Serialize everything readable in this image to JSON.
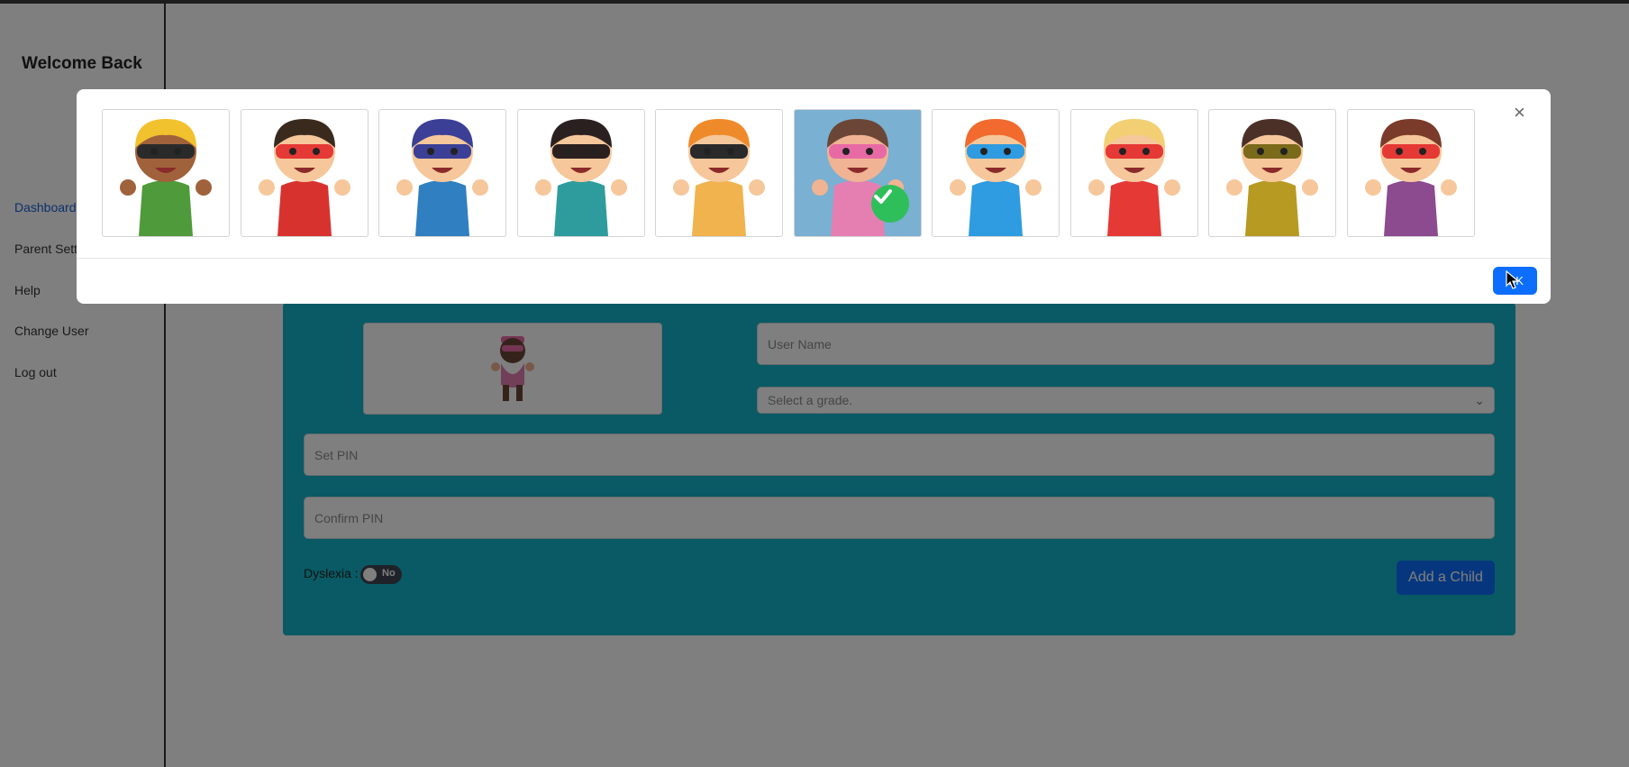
{
  "sidebar": {
    "welcome": "Welcome Back",
    "items": [
      {
        "label": "Dashboard",
        "active": true
      },
      {
        "label": "Parent Sett",
        "active": false
      },
      {
        "label": "Help",
        "active": false
      },
      {
        "label": "Change User",
        "active": false
      },
      {
        "label": "Log out",
        "active": false
      }
    ]
  },
  "form": {
    "username_placeholder": "User Name",
    "grade_placeholder": "Select a grade.",
    "pin_placeholder": "Set PIN",
    "confirm_pin_placeholder": "Confirm PIN",
    "dyslexia_label": "Dyslexia :",
    "dyslexia_toggle": "No",
    "add_button": "Add a Child"
  },
  "modal": {
    "close_glyph": "×",
    "ok_label": "OK",
    "selected_index": 5,
    "avatars": [
      {
        "name": "helmet-hero",
        "hair": "#f2c12e",
        "mask": "#2a2a2a",
        "body": "#4f9a3a",
        "skin": "#a0623b",
        "selected": false
      },
      {
        "name": "red-mask-boy",
        "hair": "#3a2a1e",
        "mask": "#e53935",
        "body": "#d8322f",
        "skin": "#f6c79a",
        "selected": false
      },
      {
        "name": "blue-caped-hero",
        "hair": "#3b3f96",
        "mask": "#3b3f96",
        "body": "#2f7fc1",
        "skin": "#f6c79a",
        "selected": false
      },
      {
        "name": "lightning-hero",
        "hair": "#2b2020",
        "mask": "#2b2020",
        "body": "#2e9c9c",
        "skin": "#f6c79a",
        "selected": false
      },
      {
        "name": "spiky-hero",
        "hair": "#ef8a2a",
        "mask": "#2a2a2a",
        "body": "#f1b34d",
        "skin": "#f6c79a",
        "selected": false
      },
      {
        "name": "bearded-hero",
        "hair": "#6b4636",
        "mask": "#e86aa5",
        "body": "#e57fb2",
        "skin": "#f0b393",
        "selected": true
      },
      {
        "name": "goggle-girl",
        "hair": "#f26a2e",
        "mask": "#2f9be0",
        "body": "#2f9be0",
        "skin": "#f6c79a",
        "selected": false
      },
      {
        "name": "blonde-heroine",
        "hair": "#f3cf74",
        "mask": "#e53935",
        "body": "#e53935",
        "skin": "#f6c79a",
        "selected": false
      },
      {
        "name": "flying-heroine",
        "hair": "#4a3026",
        "mask": "#7a6a1a",
        "body": "#b79a22",
        "skin": "#f6c79a",
        "selected": false
      },
      {
        "name": "purple-caped-girl",
        "hair": "#7a3b2a",
        "mask": "#e53935",
        "body": "#8c4a8f",
        "skin": "#f6c79a",
        "selected": false
      }
    ]
  }
}
